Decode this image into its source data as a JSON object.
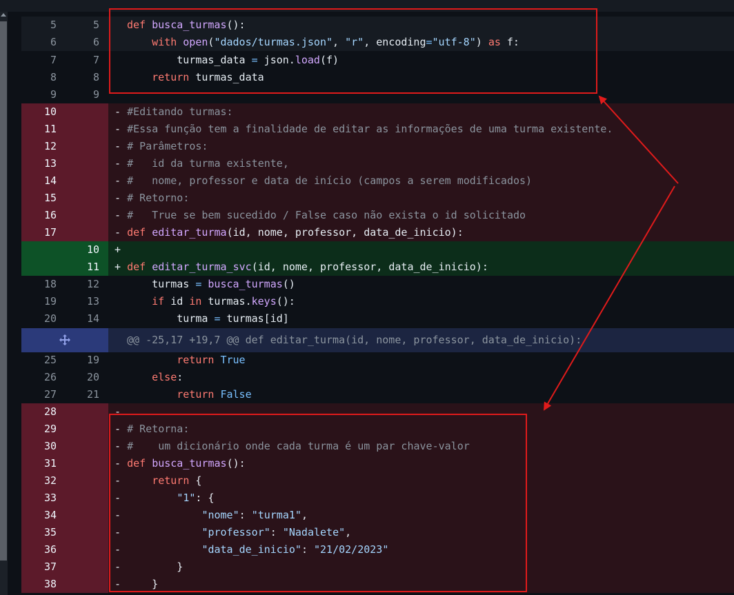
{
  "diff": {
    "hunk_header": "@@ -25,17 +19,7 @@ def editar_turma(id, nome, professor, data_de_inicio):",
    "rows": [
      {
        "type": "ctx",
        "old": "5",
        "new": "5",
        "code": "def busca_turmas():"
      },
      {
        "type": "ctx",
        "old": "6",
        "new": "6",
        "code": "    with open(\"dados/turmas.json\", \"r\", encoding=\"utf-8\") as f:"
      },
      {
        "type": "ctx",
        "old": "7",
        "new": "7",
        "code": "        turmas_data = json.load(f)"
      },
      {
        "type": "ctx",
        "old": "8",
        "new": "8",
        "code": "    return turmas_data"
      },
      {
        "type": "ctx",
        "old": "9",
        "new": "9",
        "code": ""
      },
      {
        "type": "del",
        "old": "10",
        "new": "",
        "code": "- #Editando turmas:"
      },
      {
        "type": "del",
        "old": "11",
        "new": "",
        "code": "- #Essa função tem a finalidade de editar as informações de uma turma existente."
      },
      {
        "type": "del",
        "old": "12",
        "new": "",
        "code": "- # Parâmetros:"
      },
      {
        "type": "del",
        "old": "13",
        "new": "",
        "code": "- #   id da turma existente,"
      },
      {
        "type": "del",
        "old": "14",
        "new": "",
        "code": "- #   nome, professor e data de início (campos a serem modificados)"
      },
      {
        "type": "del",
        "old": "15",
        "new": "",
        "code": "- # Retorno:"
      },
      {
        "type": "del",
        "old": "16",
        "new": "",
        "code": "- #   True se bem sucedido / False caso não exista o id solicitado"
      },
      {
        "type": "del",
        "old": "17",
        "new": "",
        "code": "- def editar_turma(id, nome, professor, data_de_inicio):"
      },
      {
        "type": "add",
        "old": "",
        "new": "10",
        "code": "+"
      },
      {
        "type": "add",
        "old": "",
        "new": "11",
        "code": "+ def editar_turma_svc(id, nome, professor, data_de_inicio):"
      },
      {
        "type": "ctx",
        "old": "18",
        "new": "12",
        "code": "    turmas = busca_turmas()"
      },
      {
        "type": "ctx",
        "old": "19",
        "new": "13",
        "code": "    if id in turmas.keys():"
      },
      {
        "type": "ctx",
        "old": "20",
        "new": "14",
        "code": "        turma = turmas[id]"
      },
      {
        "type": "ctx",
        "old": "25",
        "new": "19",
        "code": "        return True"
      },
      {
        "type": "ctx",
        "old": "26",
        "new": "20",
        "code": "    else:"
      },
      {
        "type": "ctx",
        "old": "27",
        "new": "21",
        "code": "        return False"
      },
      {
        "type": "del",
        "old": "28",
        "new": "",
        "code": "-"
      },
      {
        "type": "del",
        "old": "29",
        "new": "",
        "code": "- # Retorna:"
      },
      {
        "type": "del",
        "old": "30",
        "new": "",
        "code": "- #    um dicionário onde cada turma é um par chave-valor"
      },
      {
        "type": "del",
        "old": "31",
        "new": "",
        "code": "- def busca_turmas():"
      },
      {
        "type": "del",
        "old": "32",
        "new": "",
        "code": "-     return {"
      },
      {
        "type": "del",
        "old": "33",
        "new": "",
        "code": "-         \"1\": {"
      },
      {
        "type": "del",
        "old": "34",
        "new": "",
        "code": "-             \"nome\": \"turma1\","
      },
      {
        "type": "del",
        "old": "35",
        "new": "",
        "code": "-             \"professor\": \"Nadalete\","
      },
      {
        "type": "del",
        "old": "36",
        "new": "",
        "code": "-             \"data_de_inicio\": \"21/02/2023\""
      },
      {
        "type": "del",
        "old": "37",
        "new": "",
        "code": "-         }"
      },
      {
        "type": "del",
        "old": "38",
        "new": "",
        "code": "-     }"
      }
    ]
  },
  "icons": {
    "expand": "expand-hunk-icon",
    "scroll_up": "scroll-up-arrow-icon"
  },
  "colors": {
    "annotation": "#e01b1b",
    "deleted": "#5c1a2a",
    "added": "#0d5227",
    "hunk": "#2b3a7a"
  }
}
